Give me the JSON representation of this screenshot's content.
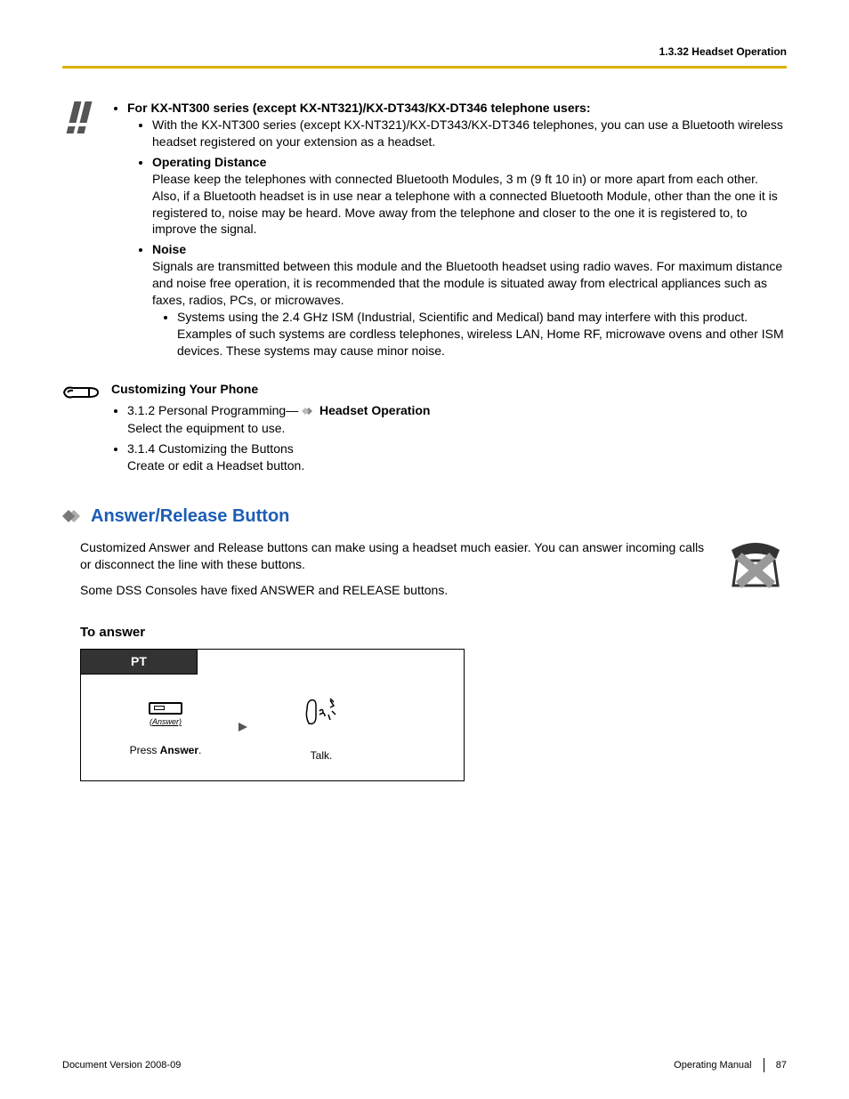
{
  "header": {
    "section_label": "1.3.32 Headset Operation"
  },
  "important": {
    "l1_bold": "For KX-NT300 series (except KX-NT321)/KX-DT343/KX-DT346 telephone users:",
    "l1_sub1": "With the KX-NT300 series (except KX-NT321)/KX-DT343/KX-DT346 telephones, you can use a Bluetooth wireless headset registered on your extension as a headset.",
    "l1_sub2_bold": "Operating Distance",
    "l1_sub2_text": "Please keep the telephones with connected Bluetooth Modules, 3 m (9 ft 10 in) or more apart from each other. Also, if a Bluetooth headset is in use near a telephone with a connected Bluetooth Module, other than the one it is registered to, noise may be heard. Move away from the telephone and closer to the one it is registered to, to improve the signal.",
    "l1_sub3_bold": "Noise",
    "l1_sub3_text": "Signals are transmitted between this module and the Bluetooth headset using radio waves. For maximum distance and noise free operation, it is recommended that the module is situated away from electrical appliances such as faxes, radios, PCs, or microwaves.",
    "l1_sub3_sub": "Systems using the 2.4 GHz ISM (Industrial, Scientific and Medical) band may interfere with this product. Examples of such systems are cordless telephones, wireless LAN, Home RF, microwave ovens and other ISM devices. These systems may cause minor noise."
  },
  "customize": {
    "title": "Customizing Your Phone",
    "item1_pre": "3.1.2  Personal Programming—",
    "item1_bold": " Headset Operation",
    "item1_sub": "Select the equipment to use.",
    "item2": "3.1.4  Customizing the Buttons",
    "item2_sub": "Create or edit a Headset button."
  },
  "answer": {
    "heading": "Answer/Release Button",
    "para1": "Customized Answer and Release buttons can make using a headset much easier. You can answer incoming calls or disconnect the line with these buttons.",
    "para2": "Some DSS Consoles have fixed ANSWER and RELEASE buttons.",
    "to_answer": "To answer",
    "tab": "PT",
    "btn_label": "(Answer)",
    "step1_caption_pre": "Press ",
    "step1_caption_bold": "Answer",
    "step1_caption_post": ".",
    "step2_caption": "Talk."
  },
  "footer": {
    "left": "Document Version  2008-09",
    "right_label": "Operating Manual",
    "page": "87"
  }
}
